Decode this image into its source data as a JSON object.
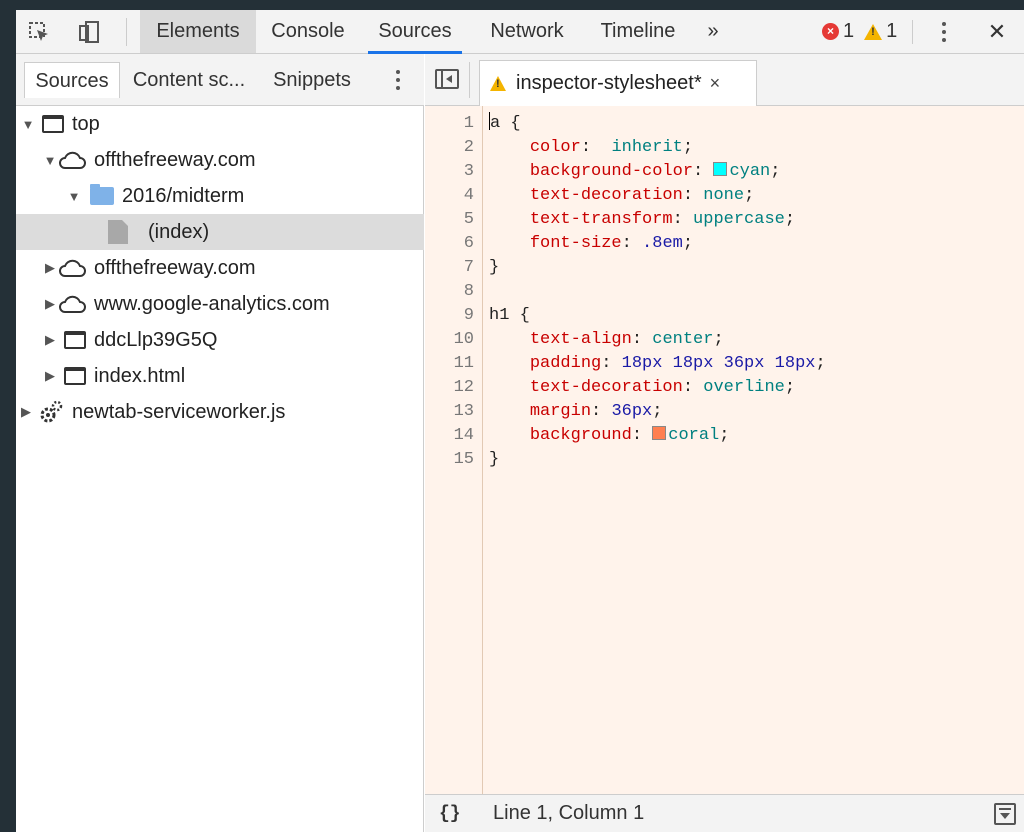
{
  "toolbar": {
    "tabs": [
      "Elements",
      "Console",
      "Sources",
      "Network",
      "Timeline"
    ],
    "overflow": "»",
    "error_count": "1",
    "warning_count": "1",
    "close": "✕"
  },
  "navigator": {
    "tabs": [
      "Sources",
      "Content sc...",
      "Snippets"
    ],
    "tree": [
      {
        "label": "top",
        "expanded": true,
        "icon": "frame-icon"
      },
      {
        "label": "offthefreeway.com",
        "expanded": true,
        "icon": "cloud-icon"
      },
      {
        "label": "2016/midterm",
        "expanded": true,
        "icon": "folder-icon"
      },
      {
        "label": "(index)",
        "selected": true,
        "icon": "file-icon"
      },
      {
        "label": "offthefreeway.com",
        "expanded": false,
        "icon": "cloud-icon"
      },
      {
        "label": "www.google-analytics.com",
        "expanded": false,
        "icon": "cloud-icon"
      },
      {
        "label": "ddcLlp39G5Q",
        "expanded": false,
        "icon": "frame-icon"
      },
      {
        "label": "index.html",
        "expanded": false,
        "icon": "frame-icon"
      },
      {
        "label": "newtab-serviceworker.js",
        "expanded": false,
        "icon": "gear-icon"
      }
    ]
  },
  "editor": {
    "file_tab": "inspector-stylesheet*",
    "close": "×",
    "line_numbers": [
      "1",
      "2",
      "3",
      "4",
      "5",
      "6",
      "7",
      "8",
      "9",
      "10",
      "11",
      "12",
      "13",
      "14",
      "15"
    ],
    "lines": [
      {
        "t": "a {"
      },
      {
        "p": "color",
        "sep": ":  ",
        "v": "inherit",
        "vc": "kw"
      },
      {
        "p": "background-color",
        "sep": ": ",
        "v": "cyan",
        "vc": "kw",
        "swatch": "#00ffff"
      },
      {
        "p": "text-decoration",
        "sep": ": ",
        "v": "none",
        "vc": "kw"
      },
      {
        "p": "text-transform",
        "sep": ": ",
        "v": "uppercase",
        "vc": "kw"
      },
      {
        "p": "font-size",
        "sep": ": ",
        "v": ".8em",
        "vc": "val"
      },
      {
        "t": "}"
      },
      {
        "t": ""
      },
      {
        "t": "h1 {"
      },
      {
        "p": "text-align",
        "sep": ": ",
        "v": "center",
        "vc": "kw"
      },
      {
        "p": "padding",
        "sep": ": ",
        "v": "18px 18px 36px 18px",
        "vc": "val"
      },
      {
        "p": "text-decoration",
        "sep": ": ",
        "v": "overline",
        "vc": "kw"
      },
      {
        "p": "margin",
        "sep": ": ",
        "v": "36px",
        "vc": "val"
      },
      {
        "p": "background",
        "sep": ": ",
        "v": "coral",
        "vc": "kw",
        "swatch": "#ff7f50"
      },
      {
        "t": "}"
      }
    ]
  },
  "status": {
    "format_button": "{}",
    "position": "Line 1, Column 1"
  },
  "colors": {
    "accent": "#1a73e8",
    "error": "#e53935",
    "warning": "#f4b400",
    "editor_bg": "#fff3eb"
  }
}
